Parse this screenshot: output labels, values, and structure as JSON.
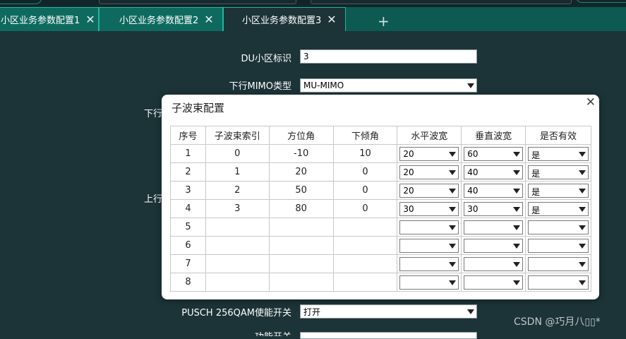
{
  "tabs": [
    {
      "label": "小区业务参数配置1",
      "active": false
    },
    {
      "label": "小区业务参数配置2",
      "active": false
    },
    {
      "label": "小区业务参数配置3",
      "active": true
    }
  ],
  "add_tab_symbol": "+",
  "close_symbol": "✕",
  "form": {
    "du_cell_id": {
      "label": "DU小区标识",
      "value": "3"
    },
    "dl_mimo_type": {
      "label": "下行MIMO类型",
      "value": "MU-MIMO"
    },
    "partial_dl_label": "下行",
    "partial_ul_label": "上行",
    "pusch_256qam": {
      "label": "PUSCH 256QAM使能开关",
      "value": "打开"
    },
    "bottom_partial_label": "功能开关"
  },
  "dialog": {
    "title": "子波束配置",
    "columns": [
      "序号",
      "子波束索引",
      "方位角",
      "下倾角",
      "水平波宽",
      "垂直波宽",
      "是否有效"
    ],
    "rows": [
      {
        "seq": "1",
        "index": "0",
        "azimuth": "-10",
        "tilt": "10",
        "h_width": "20",
        "v_width": "60",
        "valid": "是"
      },
      {
        "seq": "2",
        "index": "1",
        "azimuth": "20",
        "tilt": "0",
        "h_width": "20",
        "v_width": "40",
        "valid": "是"
      },
      {
        "seq": "3",
        "index": "2",
        "azimuth": "50",
        "tilt": "0",
        "h_width": "20",
        "v_width": "40",
        "valid": "是"
      },
      {
        "seq": "4",
        "index": "3",
        "azimuth": "80",
        "tilt": "0",
        "h_width": "30",
        "v_width": "30",
        "valid": "是"
      },
      {
        "seq": "5",
        "index": "",
        "azimuth": "",
        "tilt": "",
        "h_width": "",
        "v_width": "",
        "valid": ""
      },
      {
        "seq": "6",
        "index": "",
        "azimuth": "",
        "tilt": "",
        "h_width": "",
        "v_width": "",
        "valid": ""
      },
      {
        "seq": "7",
        "index": "",
        "azimuth": "",
        "tilt": "",
        "h_width": "",
        "v_width": "",
        "valid": ""
      },
      {
        "seq": "8",
        "index": "",
        "azimuth": "",
        "tilt": "",
        "h_width": "",
        "v_width": "",
        "valid": ""
      }
    ]
  },
  "watermark": "CSDN @巧月八▯▯*"
}
